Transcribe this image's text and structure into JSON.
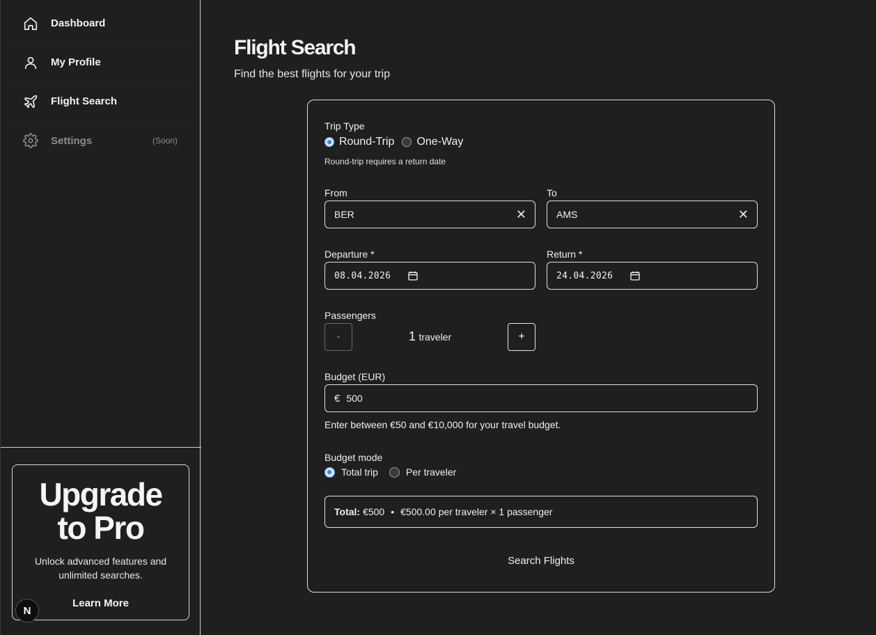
{
  "sidebar": {
    "items": [
      {
        "label": "Dashboard",
        "icon": "home-icon"
      },
      {
        "label": "My Profile",
        "icon": "user-icon"
      },
      {
        "label": "Flight Search",
        "icon": "plane-icon"
      },
      {
        "label": "Settings",
        "icon": "gear-icon",
        "badge": "(Soon)"
      }
    ],
    "promo": {
      "title_line1": "Upgrade",
      "title_line2": "to Pro",
      "text": "Unlock advanced features and unlimited searches.",
      "button": "Learn More"
    },
    "badge_letter": "N"
  },
  "main": {
    "title": "Flight Search",
    "subtitle": "Find the best flights for your trip",
    "form": {
      "trip_type": {
        "label": "Trip Type",
        "options": [
          "Round-Trip",
          "One-Way"
        ],
        "selected": "Round-Trip",
        "hint": "Round-trip requires a return date"
      },
      "from": {
        "label": "From",
        "value": "BER"
      },
      "to": {
        "label": "To",
        "value": "AMS"
      },
      "departure": {
        "label": "Departure *",
        "value": "08.04.2026"
      },
      "return": {
        "label": "Return *",
        "value": "24.04.2026"
      },
      "passengers": {
        "label": "Passengers",
        "count": "1",
        "unit": "traveler",
        "minus": "-",
        "plus": "+"
      },
      "budget": {
        "label": "Budget (EUR)",
        "currency": "€",
        "value": "500",
        "hint": "Enter between €50 and €10,000 for your travel budget."
      },
      "budget_mode": {
        "label": "Budget mode",
        "options": [
          "Total trip",
          "Per traveler"
        ],
        "selected": "Total trip"
      },
      "summary": {
        "total_label": "Total:",
        "total_value": "€500",
        "separator": "•",
        "per_traveler": "€500.00 per traveler × 1 passenger"
      },
      "submit": "Search Flights"
    }
  },
  "colors": {
    "background": "#1f1f1f",
    "radio_accent": "#3b82f6",
    "border": "#e0e0e0"
  }
}
